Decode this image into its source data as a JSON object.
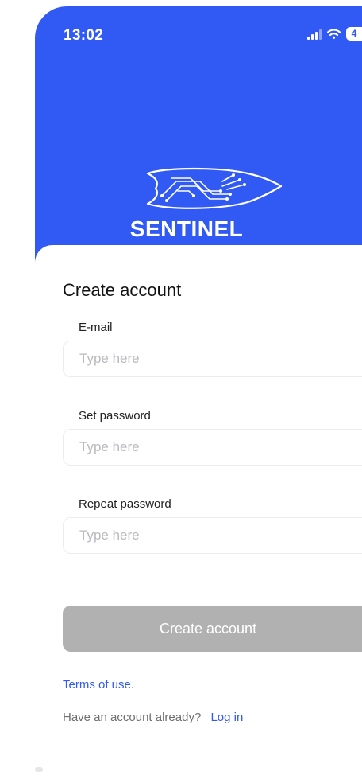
{
  "status_bar": {
    "time": "13:02",
    "battery": "4"
  },
  "brand": {
    "name": "SENTINEL"
  },
  "form": {
    "title": "Create account",
    "fields": [
      {
        "label": "E-mail",
        "placeholder": "Type here",
        "value": ""
      },
      {
        "label": "Set password",
        "placeholder": "Type here",
        "value": ""
      },
      {
        "label": "Repeat password",
        "placeholder": "Type here",
        "value": ""
      }
    ],
    "submit_label": "Create account"
  },
  "links": {
    "terms": "Terms of use.",
    "have_account": "Have an account already?",
    "login": "Log in"
  },
  "colors": {
    "brand_blue": "#3159f3",
    "button_disabled": "#b1b1b1",
    "link": "#3159f3"
  },
  "icons": [
    "signal-icon",
    "wifi-icon",
    "battery-icon",
    "sentinel-logo-icon"
  ]
}
